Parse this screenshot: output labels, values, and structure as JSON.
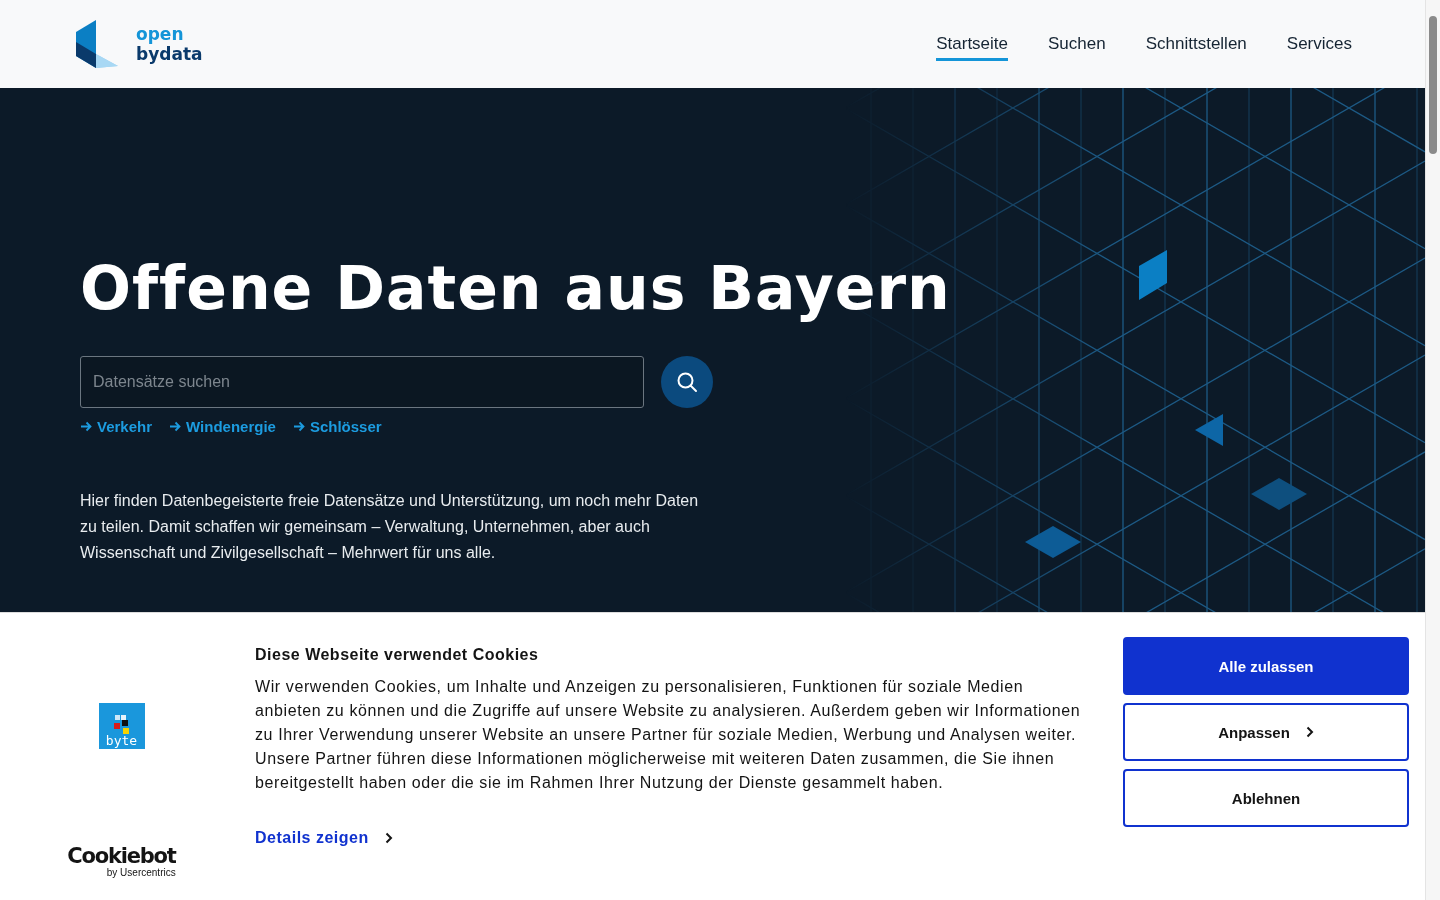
{
  "header": {
    "logo": {
      "line_1": "open",
      "line_2": "bydata"
    },
    "nav": [
      {
        "label": "Startseite",
        "selected": true
      },
      {
        "label": "Suchen",
        "selected": false
      },
      {
        "label": "Schnittstellen",
        "selected": false
      },
      {
        "label": "Services",
        "selected": false
      }
    ]
  },
  "hero": {
    "title": "Offene Daten aus Bayern",
    "search": {
      "placeholder": "Datensätze suchen"
    },
    "quick_links": [
      {
        "label": "Verkehr"
      },
      {
        "label": "Windenergie"
      },
      {
        "label": "Schlösser"
      }
    ],
    "description": "Hier finden Datenbegeisterte freie Datensätze und Unterstützung, um noch mehr Daten zu teilen. Damit schaffen wir gemeinsam – Verwaltung, Unternehmen, aber auch Wissenschaft und Zivilgesellschaft – Mehrwert für uns alle."
  },
  "cookie_banner": {
    "brand_logo": "byte",
    "provider_logo": {
      "name": "Cookiebot",
      "byline": "by Usercentrics"
    },
    "title": "Diese Webseite verwendet Cookies",
    "text": "Wir verwenden Cookies, um Inhalte und Anzeigen zu personalisieren, Funktionen für soziale Medien anbieten zu können und die Zugriffe auf unsere Website zu analysieren. Außerdem geben wir Informationen zu Ihrer Verwendung unserer Website an unsere Partner für soziale Medien, Werbung und Analysen weiter. Unsere Partner führen diese Informationen möglicherweise mit weiteren Daten zusammen, die Sie ihnen bereitgestellt haben oder die sie im Rahmen Ihrer Nutzung der Dienste gesammelt haben.",
    "details_link": "Details zeigen",
    "buttons": [
      {
        "label": "Alle zulassen",
        "kind": "primary"
      },
      {
        "label": "Anpassen",
        "kind": "expand"
      },
      {
        "label": "Ablehnen",
        "kind": "outline"
      }
    ]
  }
}
